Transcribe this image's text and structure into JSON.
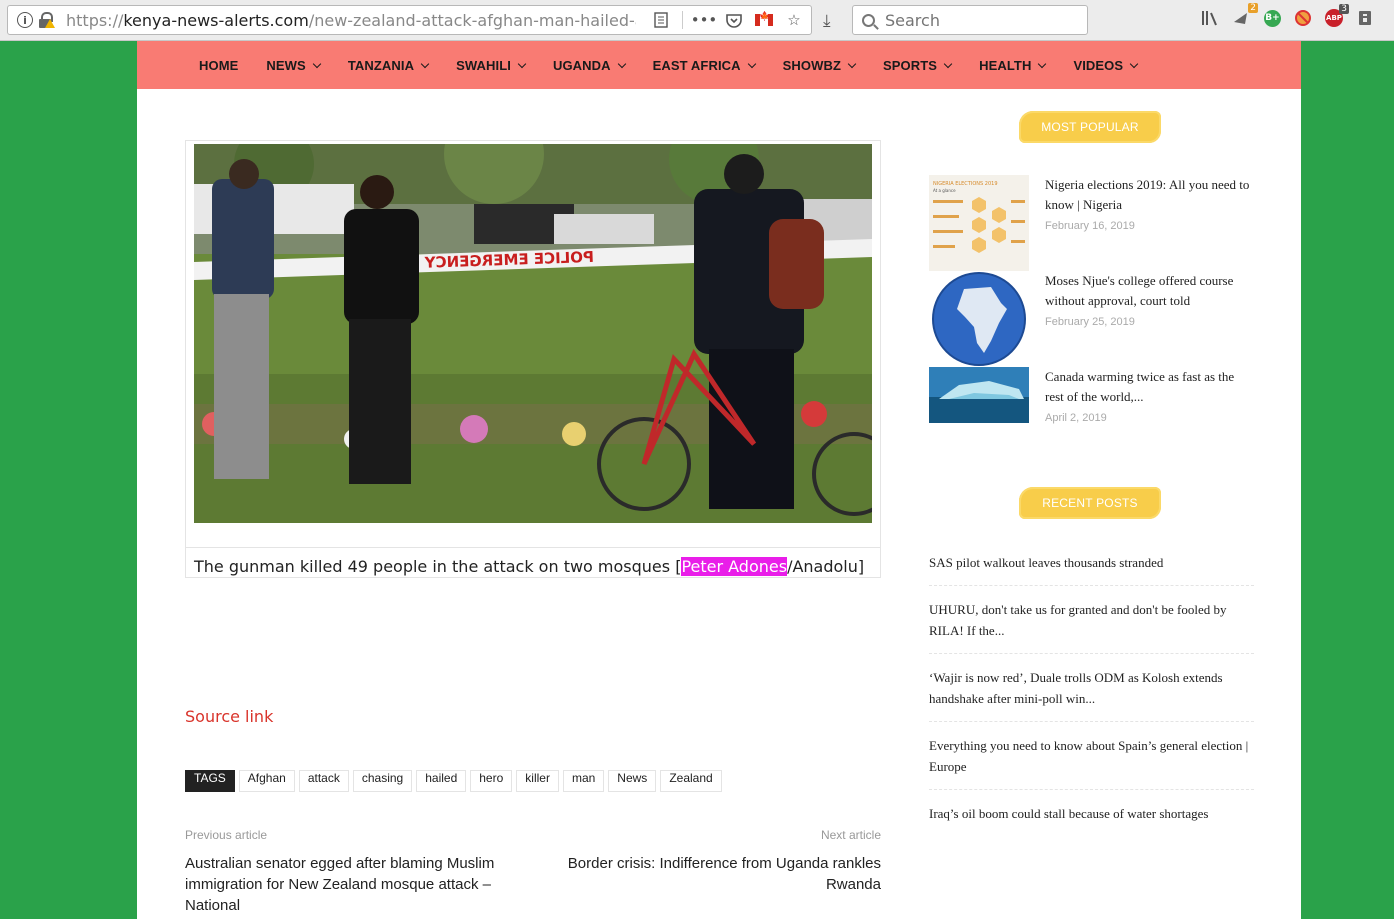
{
  "browser": {
    "url_prefix": "https://",
    "url_domain": "kenya-news-alerts.com",
    "url_path": "/new-zealand-attack-afghan-man-hailed-as-h",
    "search_placeholder": "Search",
    "badges": {
      "ext1": "2",
      "ext2": "3"
    },
    "ext_labels": {
      "bplus": "B+",
      "abp": "ABP"
    }
  },
  "nav": {
    "items": [
      "HOME",
      "NEWS",
      "TANZANIA",
      "SWAHILI",
      "UGANDA",
      "EAST AFRICA",
      "SHOWBZ",
      "SPORTS",
      "HEALTH",
      "VIDEOS"
    ]
  },
  "article": {
    "caption_before": "The gunman killed 49 people in the attack on two mosques [",
    "caption_highlight": "Peter Adones",
    "caption_after": "/Anadolu]",
    "tape_text": "POLICE EMERGENCY",
    "source_link": "Source link",
    "tags_label": "TAGS",
    "tags": [
      "Afghan",
      "attack",
      "chasing",
      "hailed",
      "hero",
      "killer",
      "man",
      "News",
      "Zealand"
    ],
    "prev_label": "Previous article",
    "next_label": "Next article",
    "prev_title": "Australian senator egged after blaming Muslim immigration for New Zealand mosque attack – National",
    "next_title": "Border crisis: Indifference from Uganda rankles Rwanda"
  },
  "sidebar": {
    "most_popular_title": "MOST POPULAR",
    "popular": [
      {
        "title": "Nigeria elections 2019: All you need to know | Nigeria",
        "date": "February 16, 2019",
        "thumb_header": "NIGERIA ELECTIONS 2019",
        "thumb_sub": "At a glance"
      },
      {
        "title": "Moses Njue's college offered course without approval, court told",
        "date": "February 25, 2019"
      },
      {
        "title": "Canada warming twice as fast as the rest of the world,...",
        "date": "April 2, 2019"
      }
    ],
    "recent_title": "RECENT POSTS",
    "recent": [
      "SAS pilot walkout leaves thousands stranded",
      "UHURU, don't take us for granted and don't be fooled by RILA! If the...",
      "‘Wajir is now red’, Duale trolls ODM as Kolosh extends handshake after mini-poll win...",
      "Everything you need to know about Spain’s general election | Europe",
      "Iraq’s oil boom could stall because of water shortages"
    ]
  }
}
